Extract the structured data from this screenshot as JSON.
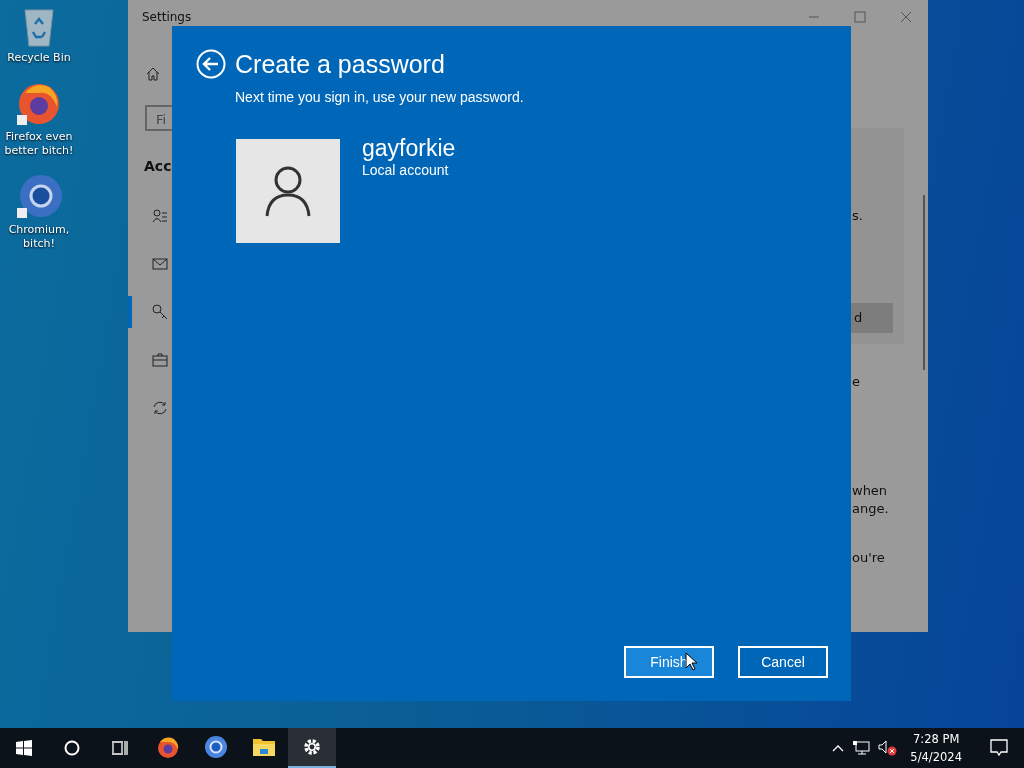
{
  "desktop_icons": [
    {
      "kind": "recycle",
      "label": "Recycle Bin"
    },
    {
      "kind": "firefox",
      "label": "Firefox even better bitch!"
    },
    {
      "kind": "chromium",
      "label": "Chromium, bitch!"
    }
  ],
  "settings_window": {
    "title": "Settings",
    "search": {
      "value": "Fi"
    },
    "heading": "Acc",
    "nav_items": [
      {
        "kind": "person-list",
        "selected": false
      },
      {
        "kind": "mail",
        "selected": false
      },
      {
        "kind": "key",
        "selected": true
      },
      {
        "kind": "briefcase",
        "selected": false
      },
      {
        "kind": "sync",
        "selected": false
      }
    ],
    "fragments": [
      {
        "kind": "text",
        "text": "s."
      },
      {
        "kind": "button",
        "text": "d"
      },
      {
        "kind": "text",
        "text": "e"
      },
      {
        "kind": "text",
        "text": "when"
      },
      {
        "kind": "text",
        "text": "ange."
      },
      {
        "kind": "text",
        "text": "ou're"
      }
    ]
  },
  "dialog": {
    "title": "Create a password",
    "subtitle": "Next time you sign in, use your new password.",
    "user_name": "gayforkie",
    "account_type": "Local account",
    "buttons": [
      {
        "label": "Finish",
        "focused": true
      },
      {
        "label": "Cancel",
        "focused": false
      }
    ]
  },
  "taskbar": {
    "apps": [
      {
        "kind": "firefox",
        "selected": false
      },
      {
        "kind": "chromium",
        "selected": false
      },
      {
        "kind": "folder",
        "selected": false
      },
      {
        "kind": "settings",
        "selected": true
      }
    ],
    "time": "7:28 PM",
    "date": "5/4/2024"
  }
}
